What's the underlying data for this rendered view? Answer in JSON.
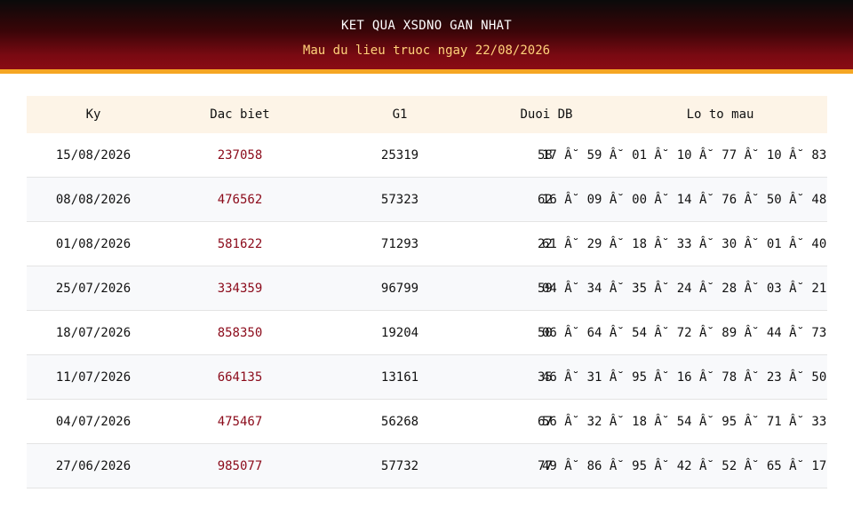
{
  "header": {
    "title": "KET QUA XSDNO GAN NHAT",
    "subtitle": "Mau du lieu truoc ngay 22/08/2026"
  },
  "table": {
    "columns": [
      "Ky",
      "Dac biet",
      "G1",
      "Duoi DB",
      "Lo to mau"
    ],
    "rows": [
      {
        "ky": "15/08/2026",
        "dac_biet": "237058",
        "g1": "25319",
        "duoi_db": "58",
        "lo_to": "17 Â˘ 59 Â˘ 01 Â˘ 10 Â˘ 77 Â˘ 10 Â˘ 83"
      },
      {
        "ky": "08/08/2026",
        "dac_biet": "476562",
        "g1": "57323",
        "duoi_db": "62",
        "lo_to": "16 Â˘ 09 Â˘ 00 Â˘ 14 Â˘ 76 Â˘ 50 Â˘ 48"
      },
      {
        "ky": "01/08/2026",
        "dac_biet": "581622",
        "g1": "71293",
        "duoi_db": "22",
        "lo_to": "61 Â˘ 29 Â˘ 18 Â˘ 33 Â˘ 30 Â˘ 01 Â˘ 40"
      },
      {
        "ky": "25/07/2026",
        "dac_biet": "334359",
        "g1": "96799",
        "duoi_db": "59",
        "lo_to": "04 Â˘ 34 Â˘ 35 Â˘ 24 Â˘ 28 Â˘ 03 Â˘ 21"
      },
      {
        "ky": "18/07/2026",
        "dac_biet": "858350",
        "g1": "19204",
        "duoi_db": "50",
        "lo_to": "06 Â˘ 64 Â˘ 54 Â˘ 72 Â˘ 89 Â˘ 44 Â˘ 73"
      },
      {
        "ky": "11/07/2026",
        "dac_biet": "664135",
        "g1": "13161",
        "duoi_db": "35",
        "lo_to": "46 Â˘ 31 Â˘ 95 Â˘ 16 Â˘ 78 Â˘ 23 Â˘ 50"
      },
      {
        "ky": "04/07/2026",
        "dac_biet": "475467",
        "g1": "56268",
        "duoi_db": "67",
        "lo_to": "56 Â˘ 32 Â˘ 18 Â˘ 54 Â˘ 95 Â˘ 71 Â˘ 33"
      },
      {
        "ky": "27/06/2026",
        "dac_biet": "985077",
        "g1": "57732",
        "duoi_db": "77",
        "lo_to": "49 Â˘ 86 Â˘ 95 Â˘ 42 Â˘ 52 Â˘ 65 Â˘ 17"
      }
    ]
  },
  "colors": {
    "accent_red": "#8b0a1a",
    "header_stripe": "#f5a623",
    "header_subtitle": "#ffd27a",
    "table_head_bg": "#fdf4e7"
  }
}
